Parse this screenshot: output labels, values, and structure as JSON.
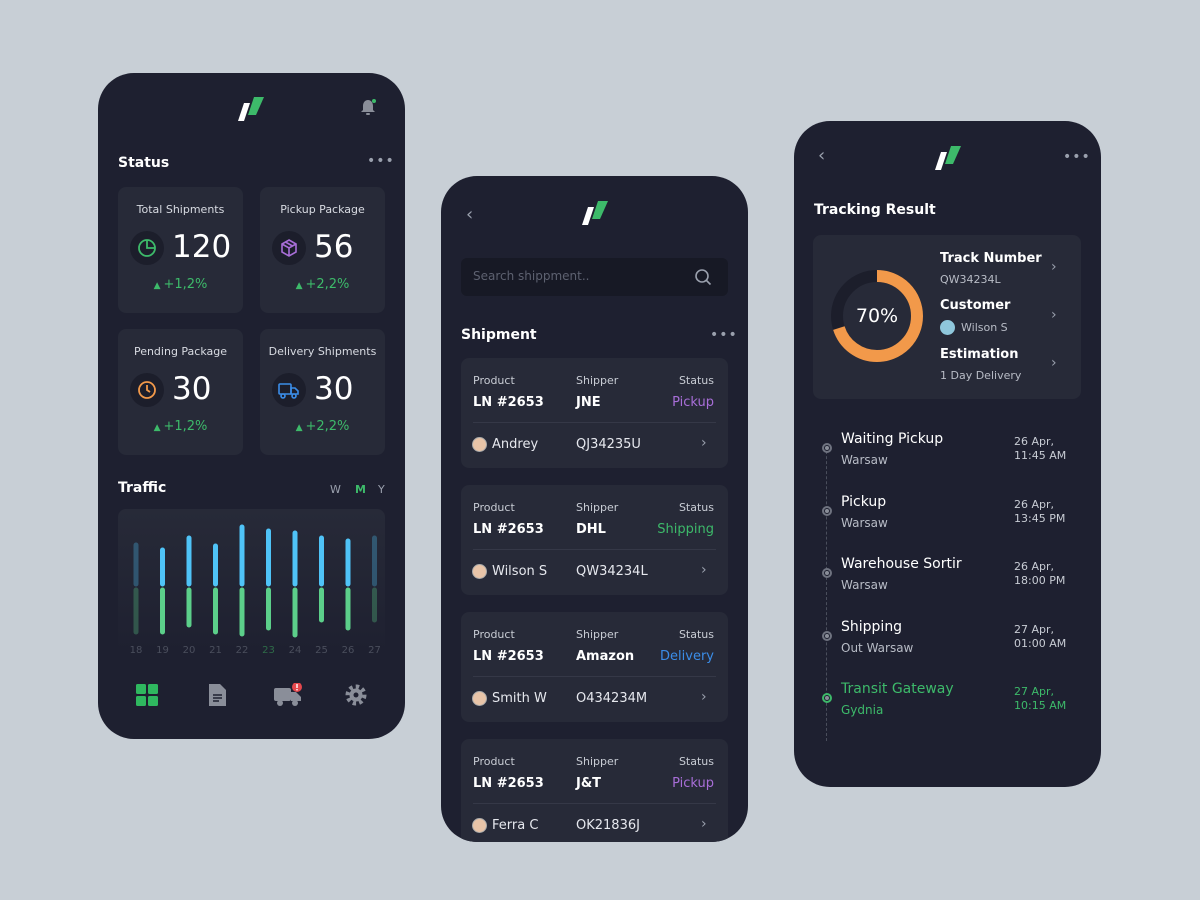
{
  "colors": {
    "background": "#c8cfd6",
    "phone": "#1e2030",
    "card": "#272a38",
    "green": "#3dba6a",
    "orange": "#f2994a",
    "purple": "#a86ed8",
    "blue": "#3b8de8",
    "cyan": "#4fc3f7"
  },
  "dashboard": {
    "status_title": "Status",
    "stats": [
      {
        "title": "Total Shipments",
        "value": "120",
        "change": "+1,2%",
        "icon": "pie-chart-icon"
      },
      {
        "title": "Pickup Package",
        "value": "56",
        "change": "+2,2%",
        "icon": "box-icon"
      },
      {
        "title": "Pending Package",
        "value": "30",
        "change": "+1,2%",
        "icon": "clock-icon"
      },
      {
        "title": "Delivery Shipments",
        "value": "30",
        "change": "+2,2%",
        "icon": "truck-icon"
      }
    ],
    "traffic_title": "Traffic",
    "periods": [
      "W",
      "M",
      "Y"
    ],
    "active_period": "M",
    "nav": [
      "grid-icon",
      "document-icon",
      "truck-icon",
      "gear-icon"
    ]
  },
  "chart_data": {
    "type": "bar",
    "title": "Traffic",
    "categories": [
      "18",
      "19",
      "20",
      "21",
      "22",
      "23",
      "24",
      "25",
      "26",
      "27"
    ],
    "highlight_category": "23",
    "series": [
      {
        "color": "#4fc3f7",
        "values": [
          39,
          34,
          46,
          38,
          57,
          53,
          51,
          46,
          43,
          46
        ]
      },
      {
        "color": "#5ccf8a",
        "values": [
          42,
          42,
          35,
          42,
          44,
          38,
          45,
          30,
          38,
          30
        ]
      }
    ]
  },
  "shipments": {
    "search_placeholder": "Search shippment..",
    "title": "Shipment",
    "labels": {
      "product": "Product",
      "shipper": "Shipper",
      "status": "Status"
    },
    "items": [
      {
        "product": "LN #2653",
        "shipper": "JNE",
        "status": "Pickup",
        "status_color": "#a86ed8",
        "name": "Andrey",
        "code": "QJ34235U"
      },
      {
        "product": "LN #2653",
        "shipper": "DHL",
        "status": "Shipping",
        "status_color": "#3dba6a",
        "name": "Wilson S",
        "code": "QW34234L"
      },
      {
        "product": "LN #2653",
        "shipper": "Amazon",
        "status": "Delivery",
        "status_color": "#3b8de8",
        "name": "Smith W",
        "code": "O434234M"
      },
      {
        "product": "LN #2653",
        "shipper": "J&T",
        "status": "Pickup",
        "status_color": "#a86ed8",
        "name": "Ferra C",
        "code": "OK21836J"
      }
    ]
  },
  "tracking": {
    "title": "Tracking Result",
    "progress_percent": 70,
    "progress_label": "70%",
    "track_label": "Track Number",
    "track_value": "QW34234L",
    "customer_label": "Customer",
    "customer_value": "Wilson S",
    "estimation_label": "Estimation",
    "estimation_value": "1 Day Delivery",
    "timeline": [
      {
        "title": "Waiting Pickup",
        "place": "Warsaw",
        "date": "26 Apr,",
        "time": "11:45 AM"
      },
      {
        "title": "Pickup",
        "place": "Warsaw",
        "date": "26 Apr,",
        "time": "13:45 PM"
      },
      {
        "title": "Warehouse Sortir",
        "place": "Warsaw",
        "date": "26 Apr,",
        "time": "18:00 PM"
      },
      {
        "title": "Shipping",
        "place": "Out Warsaw",
        "date": "27 Apr,",
        "time": "01:00 AM"
      },
      {
        "title": "Transit Gateway",
        "place": "Gydnia",
        "date": "27 Apr,",
        "time": "10:15 AM",
        "active": true
      }
    ]
  }
}
